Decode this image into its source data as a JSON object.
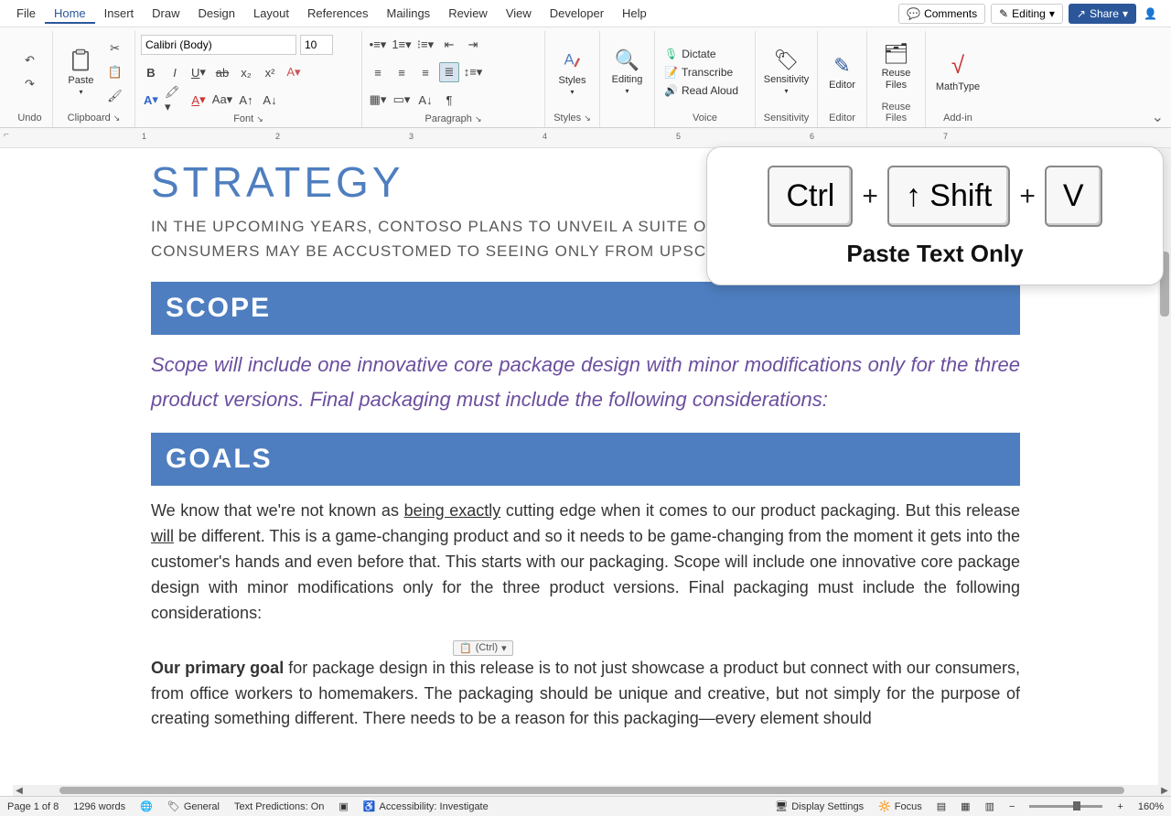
{
  "menu": {
    "items": [
      "File",
      "Home",
      "Insert",
      "Draw",
      "Design",
      "Layout",
      "References",
      "Mailings",
      "Review",
      "View",
      "Developer",
      "Help"
    ],
    "active": "Home",
    "comments": "Comments",
    "editing": "Editing",
    "share": "Share"
  },
  "ribbon": {
    "undo": "Undo",
    "clipboard": "Clipboard",
    "paste": "Paste",
    "font_group": "Font",
    "font_name": "Calibri (Body)",
    "font_size": "10",
    "paragraph": "Paragraph",
    "styles": "Styles",
    "editing": "Editing",
    "voice": "Voice",
    "dictate": "Dictate",
    "transcribe": "Transcribe",
    "read_aloud": "Read Aloud",
    "sensitivity": "Sensitivity",
    "editor": "Editor",
    "reuse_files": "Reuse Files",
    "reuse_files_btn": "Reuse\nFiles",
    "addin": "Add-in",
    "mathtype": "MathType"
  },
  "doc": {
    "strategy": "STRATEGY",
    "strategy_sub": "IN THE UPCOMING YEARS, CONTOSO PLANS TO UNVEIL A SUITE OF HIGH-TECH PACKAGING THAT CONSUMERS MAY BE ACCUSTOMED TO SEEING ONLY FROM UPSCALE ELECTRONICS.",
    "scope": "SCOPE",
    "scope_text": "Scope will include one innovative core package design with minor modifications only for the three product versions. Final packaging must include the following considerations:",
    "goals": "GOALS",
    "goals_p1_a": "We know that we're not known as ",
    "goals_p1_u": "being exactly",
    "goals_p1_b": " cutting edge when it comes to our product packaging. But this release ",
    "goals_p1_u2": "will",
    "goals_p1_c": " be different. This is a game-changing product and so it needs to be game-changing from the moment it gets into the customer's hands and even before that. This starts with our packaging. Scope will include one innovative core package design with minor modifications only for the three product versions. Final packaging must include the following considerations:",
    "goals_p2_a": "Our primary goal",
    "goals_p2_b": " for package design in this release is to not just showcase a product but connect with our consumers, from office workers to homemakers. The packaging should be unique and creative, but not simply for the purpose of creating something different. There needs to be a reason for this packaging—every element should",
    "paste_tag": "(Ctrl)"
  },
  "tooltip": {
    "key1": "Ctrl",
    "key2": "↑ Shift",
    "key3": "V",
    "label": "Paste Text Only"
  },
  "status": {
    "page": "Page 1 of 8",
    "words": "1296 words",
    "general": "General",
    "predictions": "Text Predictions: On",
    "accessibility": "Accessibility: Investigate",
    "display": "Display Settings",
    "focus": "Focus",
    "zoom": "160%"
  },
  "ruler_marks": [
    "1",
    "2",
    "3",
    "4",
    "5",
    "6",
    "7"
  ]
}
